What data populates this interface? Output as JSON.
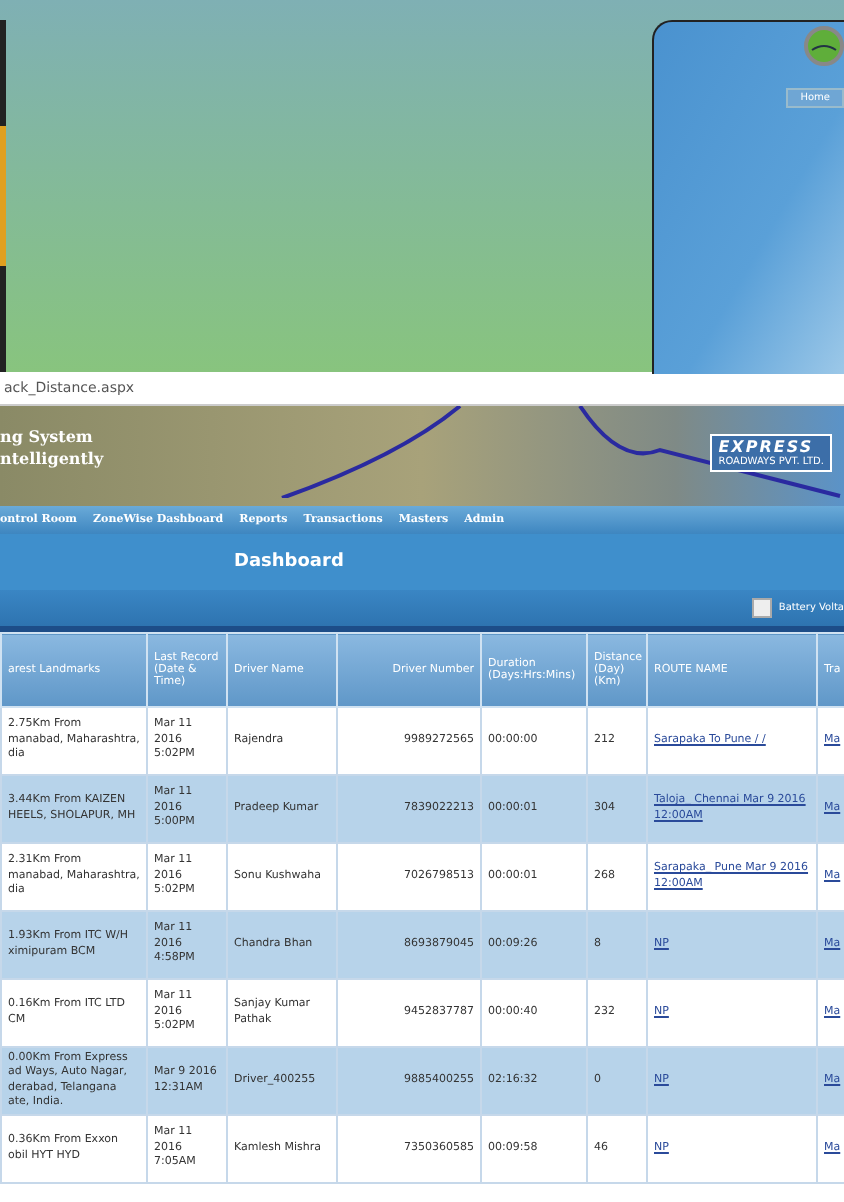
{
  "background_window": {
    "nav_button": "Home"
  },
  "address_bar": {
    "url": "ack_Distance.aspx"
  },
  "banner": {
    "title_line_1": "ng System",
    "title_line_2": "ntelligently",
    "logo_line_1": "EXPRESS",
    "logo_line_2": "ROADWAYS PVT. LTD."
  },
  "nav": [
    "ontrol Room",
    "ZoneWise Dashboard",
    "Reports",
    "Transactions",
    "Masters",
    "Admin"
  ],
  "page_title": "Dashboard",
  "toolbar": {
    "checkbox_label": "Battery Volta",
    "checked": false
  },
  "table": {
    "columns": [
      "arest Landmarks",
      "Last Record (Date & Time)",
      "Driver Name",
      "Driver Number",
      "Duration (Days:Hrs:Mins)",
      "Distance (Day) (Km)",
      "ROUTE NAME",
      "Tra"
    ],
    "rows": [
      {
        "landmark": "2.75Km From manabad, Maharashtra, dia",
        "last_record": "Mar 11 2016 5:02PM",
        "driver": "Rajendra",
        "number": "9989272565",
        "duration": "00:00:00",
        "distance": "212",
        "route": "Sarapaka To Pune / /",
        "column_8": "Ma"
      },
      {
        "landmark": "3.44Km From KAIZEN HEELS, SHOLAPUR, MH",
        "last_record": "Mar 11 2016 5:00PM",
        "driver": "Pradeep Kumar",
        "number": "7839022213",
        "duration": "00:00:01",
        "distance": "304",
        "route": "Taloja_ Chennai Mar 9 2016 12:00AM",
        "column_8": "Ma"
      },
      {
        "landmark": "2.31Km From manabad, Maharashtra, dia",
        "last_record": "Mar 11 2016 5:02PM",
        "driver": "Sonu Kushwaha",
        "number": "7026798513",
        "duration": "00:00:01",
        "distance": "268",
        "route": "Sarapaka_ Pune Mar 9 2016 12:00AM",
        "column_8": "Ma"
      },
      {
        "landmark": "1.93Km From ITC W/H ximipuram BCM",
        "last_record": "Mar 11 2016 4:58PM",
        "driver": "Chandra Bhan",
        "number": "8693879045",
        "duration": "00:09:26",
        "distance": "8",
        "route": "NP",
        "column_8": "Ma"
      },
      {
        "landmark": "0.16Km From ITC LTD CM",
        "last_record": "Mar 11 2016 5:02PM",
        "driver": "Sanjay Kumar Pathak",
        "number": "9452837787",
        "duration": "00:00:40",
        "distance": "232",
        "route": "NP",
        "column_8": "Ma"
      },
      {
        "landmark": "0.00Km From Express ad Ways, Auto Nagar, derabad, Telangana ate, India.",
        "last_record": "Mar 9 2016 12:31AM",
        "driver": "Driver_400255",
        "number": "9885400255",
        "duration": "02:16:32",
        "distance": "0",
        "route": "NP",
        "column_8": "Ma"
      },
      {
        "landmark": "0.36Km From Exxon obil HYT HYD",
        "last_record": "Mar 11 2016 7:05AM",
        "driver": "Kamlesh Mishra",
        "number": "7350360585",
        "duration": "00:09:58",
        "distance": "46",
        "route": "NP",
        "column_8": "Ma"
      }
    ]
  }
}
